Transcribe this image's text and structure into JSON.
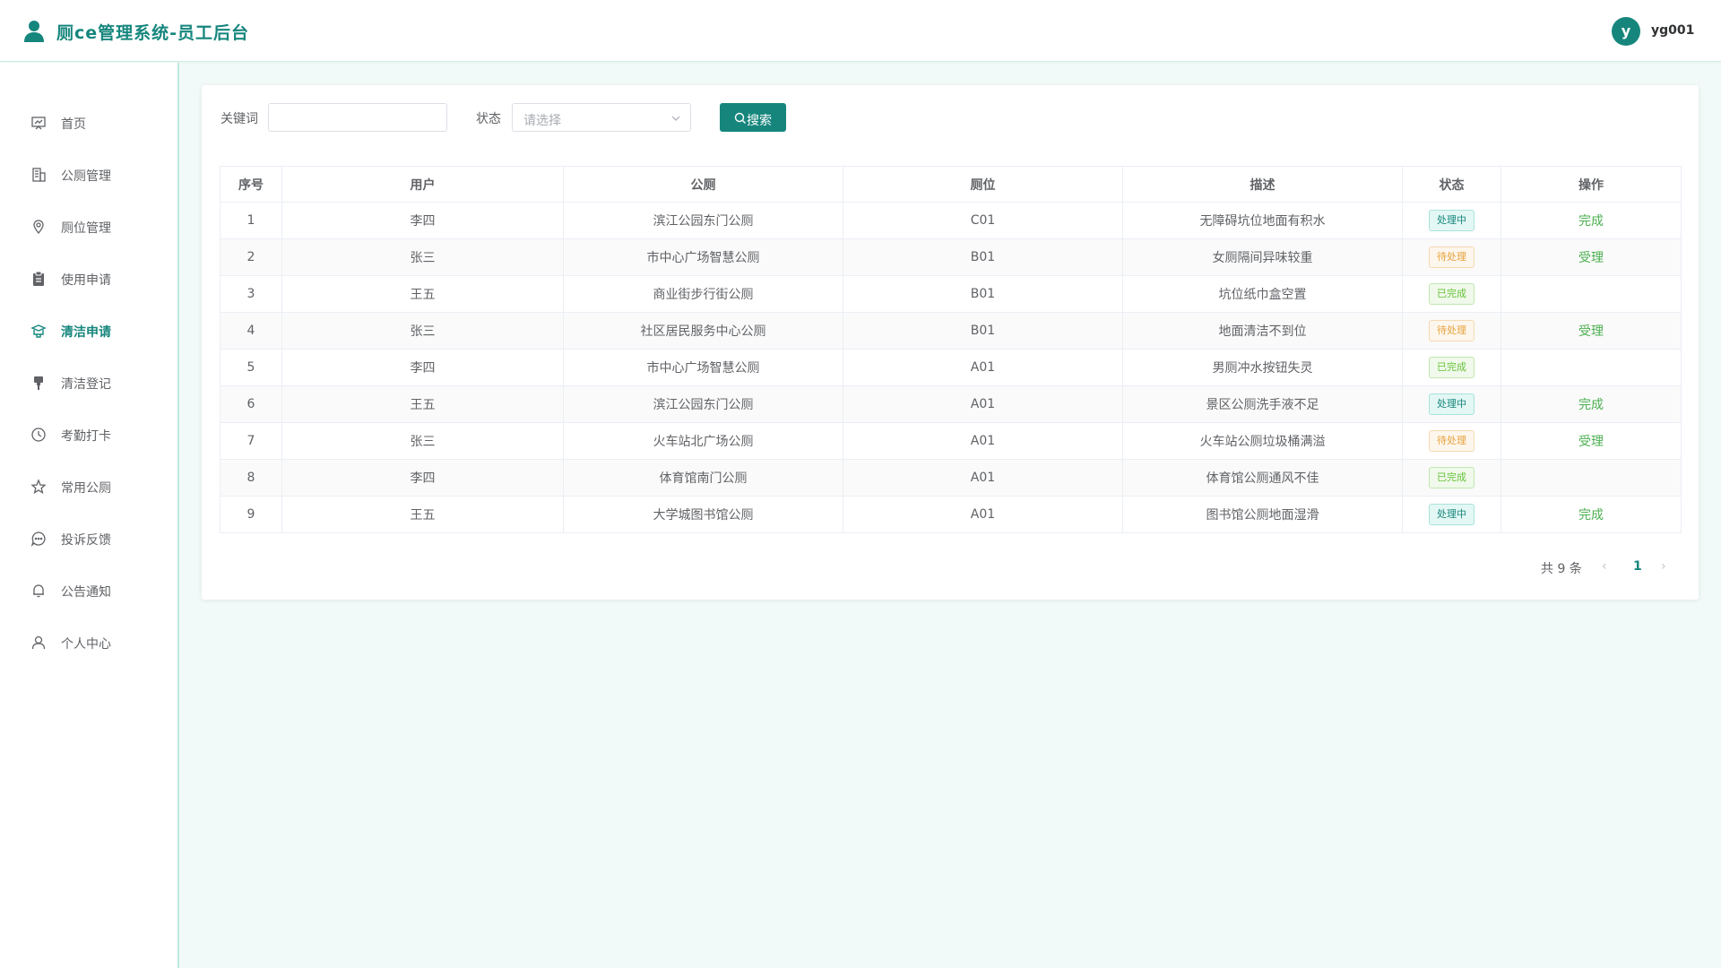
{
  "app": {
    "title": "厕ce管理系统-员工后台",
    "user_initial": "y",
    "username": "yg001",
    "accent_color": "#16867d"
  },
  "sidebar": {
    "items": [
      {
        "label": "首页",
        "icon": "dashboard-icon",
        "active": false
      },
      {
        "label": "公厕管理",
        "icon": "building-icon",
        "active": false
      },
      {
        "label": "厕位管理",
        "icon": "location-icon",
        "active": false
      },
      {
        "label": "使用申请",
        "icon": "clipboard-icon",
        "active": false
      },
      {
        "label": "清洁申请",
        "icon": "cleaning-icon",
        "active": true
      },
      {
        "label": "清洁登记",
        "icon": "brush-icon",
        "active": false
      },
      {
        "label": "考勤打卡",
        "icon": "clock-icon",
        "active": false
      },
      {
        "label": "常用公厕",
        "icon": "star-icon",
        "active": false
      },
      {
        "label": "投诉反馈",
        "icon": "chat-icon",
        "active": false
      },
      {
        "label": "公告通知",
        "icon": "bell-icon",
        "active": false
      },
      {
        "label": "个人中心",
        "icon": "user-icon",
        "active": false
      }
    ]
  },
  "filters": {
    "keyword_label": "关键词",
    "keyword_value": "",
    "status_label": "状态",
    "status_placeholder": "请选择",
    "search_label": "搜索"
  },
  "table": {
    "columns": [
      "序号",
      "用户",
      "公厕",
      "厕位",
      "描述",
      "状态",
      "操作"
    ],
    "rows": [
      {
        "no": "1",
        "user": "李四",
        "toilet": "滨江公园东门公厕",
        "stall": "C01",
        "desc": "无障碍坑位地面有积水",
        "status": "处理中",
        "status_type": "processing",
        "action": "完成"
      },
      {
        "no": "2",
        "user": "张三",
        "toilet": "市中心广场智慧公厕",
        "stall": "B01",
        "desc": "女厕隔间异味较重",
        "status": "待处理",
        "status_type": "pending",
        "action": "受理"
      },
      {
        "no": "3",
        "user": "王五",
        "toilet": "商业街步行街公厕",
        "stall": "B01",
        "desc": "坑位纸巾盒空置",
        "status": "已完成",
        "status_type": "done",
        "action": ""
      },
      {
        "no": "4",
        "user": "张三",
        "toilet": "社区居民服务中心公厕",
        "stall": "B01",
        "desc": "地面清洁不到位",
        "status": "待处理",
        "status_type": "pending",
        "action": "受理"
      },
      {
        "no": "5",
        "user": "李四",
        "toilet": "市中心广场智慧公厕",
        "stall": "A01",
        "desc": "男厕冲水按钮失灵",
        "status": "已完成",
        "status_type": "done",
        "action": ""
      },
      {
        "no": "6",
        "user": "王五",
        "toilet": "滨江公园东门公厕",
        "stall": "A01",
        "desc": "景区公厕洗手液不足",
        "status": "处理中",
        "status_type": "processing",
        "action": "完成"
      },
      {
        "no": "7",
        "user": "张三",
        "toilet": "火车站北广场公厕",
        "stall": "A01",
        "desc": "火车站公厕垃圾桶满溢",
        "status": "待处理",
        "status_type": "pending",
        "action": "受理"
      },
      {
        "no": "8",
        "user": "李四",
        "toilet": "体育馆南门公厕",
        "stall": "A01",
        "desc": "体育馆公厕通风不佳",
        "status": "已完成",
        "status_type": "done",
        "action": ""
      },
      {
        "no": "9",
        "user": "王五",
        "toilet": "大学城图书馆公厕",
        "stall": "A01",
        "desc": "图书馆公厕地面湿滑",
        "status": "处理中",
        "status_type": "processing",
        "action": "完成"
      }
    ]
  },
  "pagination": {
    "total_text": "共 9 条",
    "current_page": "1",
    "prev_symbol": "‹",
    "next_symbol": "›"
  }
}
